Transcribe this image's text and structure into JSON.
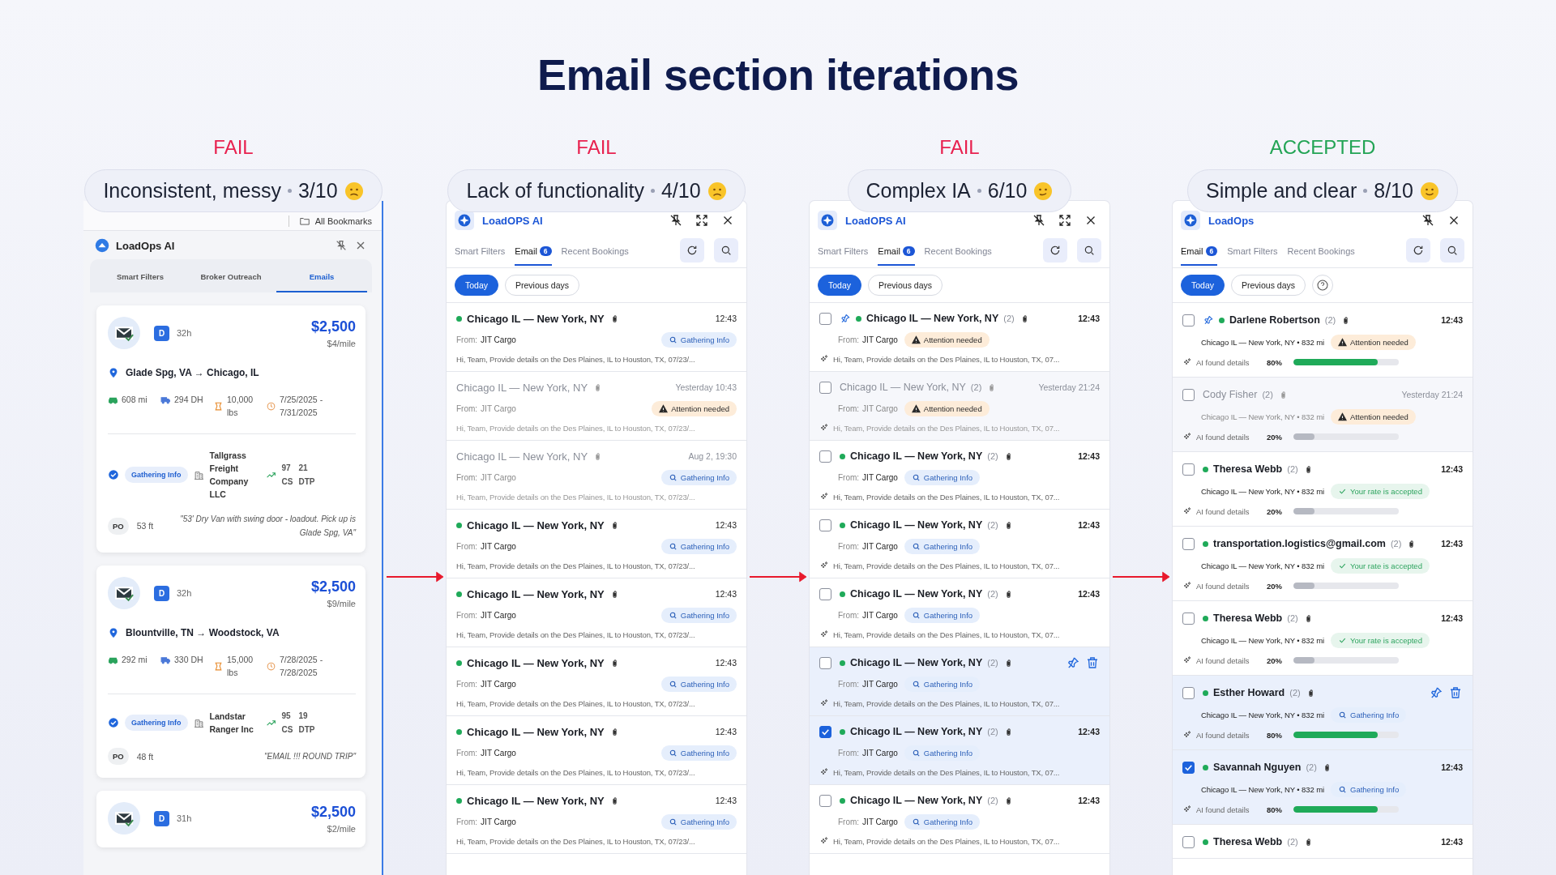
{
  "title": "Email section iterations",
  "columns": [
    {
      "verdict": "FAIL",
      "passed": false,
      "label": "Inconsistent, messy",
      "score": "3/10",
      "panel": {
        "kind": "cards",
        "bookmarks_label": "All Bookmarks",
        "app_name": "LoadOps AI",
        "tabs": [
          {
            "label": "Smart Filters",
            "selected": false
          },
          {
            "label": "Broker Outreach",
            "selected": false
          },
          {
            "label": "Emails",
            "selected": true
          }
        ],
        "cards": [
          {
            "badge": "D",
            "age": "32h",
            "price": "$2,500",
            "rate": "$4/mile",
            "route": "Glade Spg, VA → Chicago, IL",
            "stats": [
              {
                "kind": "distance",
                "text": "608 mi"
              },
              {
                "kind": "deadhead",
                "text": "294 DH"
              },
              {
                "kind": "weight",
                "text": "10,000 lbs"
              },
              {
                "kind": "dates",
                "text": "7/25/2025 - 7/31/2025"
              }
            ],
            "status": "Gathering Info",
            "company": "Tallgrass Freight Company LLC",
            "scores": [
              {
                "value": "97",
                "label": "CS"
              },
              {
                "value": "21",
                "label": "DTP"
              }
            ],
            "po": "PO",
            "length": "53 ft",
            "note": "\"53' Dry Van with swing door - loadout. Pick up is Glade Spg, VA\""
          },
          {
            "badge": "D",
            "age": "32h",
            "price": "$2,500",
            "rate": "$9/mile",
            "route": "Blountville, TN → Woodstock, VA",
            "stats": [
              {
                "kind": "distance",
                "text": "292 mi"
              },
              {
                "kind": "deadhead",
                "text": "330 DH"
              },
              {
                "kind": "weight",
                "text": "15,000 lbs"
              },
              {
                "kind": "dates",
                "text": "7/28/2025 - 7/28/2025"
              }
            ],
            "status": "Gathering Info",
            "company": "Landstar Ranger Inc",
            "scores": [
              {
                "value": "95",
                "label": "CS"
              },
              {
                "value": "19",
                "label": "DTP"
              }
            ],
            "po": "PO",
            "length": "48 ft",
            "note": "\"EMAIL !!! ROUND TRIP\""
          },
          {
            "badge": "D",
            "age": "31h",
            "price": "$2,500",
            "rate": "$2/mile"
          }
        ]
      }
    },
    {
      "verdict": "FAIL",
      "passed": false,
      "label": "Lack of functionality",
      "score": "4/10",
      "panel": {
        "kind": "simple",
        "app_name": "LoadOPS AI",
        "expand_button": true,
        "help_button": false,
        "tabs": [
          {
            "label": "Smart Filters",
            "selected": false
          },
          {
            "label": "Email",
            "badge": "6",
            "selected": true
          },
          {
            "label": "Recent Bookings",
            "selected": false
          }
        ],
        "filters": [
          {
            "label": "Today",
            "selected": true
          },
          {
            "label": "Previous days",
            "selected": false
          }
        ],
        "rows": [
          {
            "unread": true,
            "title": "Chicago IL — New York, NY",
            "time": "12:43",
            "from_label": "From:",
            "sender": "JIT Cargo",
            "status": {
              "kind": "info",
              "label": "Gathering Info"
            },
            "preview": "Hi, Team, Provide details on the Des Plaines, IL to Houston, TX, 07/23/..."
          },
          {
            "unread": false,
            "title": "Chicago IL — New York, NY",
            "time": "Yesterday 10:43",
            "from_label": "From:",
            "sender": "JIT Cargo",
            "status": {
              "kind": "attention",
              "label": "Attention needed"
            },
            "preview": "Hi, Team, Provide details on the Des Plaines, IL to Houston, TX, 07/23/..."
          },
          {
            "unread": false,
            "title": "Chicago IL — New York, NY",
            "time": "Aug 2, 19:30",
            "from_label": "From:",
            "sender": "JIT Cargo",
            "status": {
              "kind": "info",
              "label": "Gathering Info"
            },
            "preview": "Hi, Team, Provide details on the Des Plaines, IL to Houston, TX, 07/23/..."
          },
          {
            "unread": true,
            "title": "Chicago IL — New York, NY",
            "time": "12:43",
            "from_label": "From:",
            "sender": "JIT Cargo",
            "status": {
              "kind": "info",
              "label": "Gathering Info"
            },
            "preview": "Hi, Team, Provide details on the Des Plaines, IL to Houston, TX, 07/23/..."
          },
          {
            "unread": true,
            "title": "Chicago IL — New York, NY",
            "time": "12:43",
            "from_label": "From:",
            "sender": "JIT Cargo",
            "status": {
              "kind": "info",
              "label": "Gathering Info"
            },
            "preview": "Hi, Team, Provide details on the Des Plaines, IL to Houston, TX, 07/23/..."
          },
          {
            "unread": true,
            "title": "Chicago IL — New York, NY",
            "time": "12:43",
            "from_label": "From:",
            "sender": "JIT Cargo",
            "status": {
              "kind": "info",
              "label": "Gathering Info"
            },
            "preview": "Hi, Team, Provide details on the Des Plaines, IL to Houston, TX, 07/23/..."
          },
          {
            "unread": true,
            "title": "Chicago IL — New York, NY",
            "time": "12:43",
            "from_label": "From:",
            "sender": "JIT Cargo",
            "status": {
              "kind": "info",
              "label": "Gathering Info"
            },
            "preview": "Hi, Team, Provide details on the Des Plaines, IL to Houston, TX, 07/23/..."
          },
          {
            "unread": true,
            "title": "Chicago IL — New York, NY",
            "time": "12:43",
            "from_label": "From:",
            "sender": "JIT Cargo",
            "status": {
              "kind": "info",
              "label": "Gathering Info"
            },
            "preview": "Hi, Team, Provide details on the Des Plaines, IL to Houston, TX, 07/23/..."
          }
        ]
      }
    },
    {
      "verdict": "FAIL",
      "passed": false,
      "label": "Complex IA",
      "score": "6/10",
      "panel": {
        "kind": "checklist",
        "app_name": "LoadOPS AI",
        "expand_button": true,
        "help_button": false,
        "tabs": [
          {
            "label": "Smart Filters",
            "selected": false
          },
          {
            "label": "Email",
            "badge": "6",
            "selected": true
          },
          {
            "label": "Recent Bookings",
            "selected": false
          }
        ],
        "filters": [
          {
            "label": "Today",
            "selected": true
          },
          {
            "label": "Previous days",
            "selected": false
          }
        ],
        "rows": [
          {
            "checked": false,
            "pinned": true,
            "unread": true,
            "hovered": false,
            "title": "Chicago IL — New York, NY",
            "count": "(2)",
            "time": "12:43",
            "from_label": "From:",
            "sender": "JIT Cargo",
            "status": {
              "kind": "attention",
              "label": "Attention needed"
            },
            "preview": "Hi, Team, Provide details on the Des Plaines, IL to Houston, TX, 07..."
          },
          {
            "checked": false,
            "pinned": false,
            "unread": false,
            "hovered": false,
            "title": "Chicago IL — New York, NY",
            "count": "(2)",
            "time": "Yesterday 21:24",
            "from_label": "From:",
            "sender": "JIT Cargo",
            "status": {
              "kind": "attention",
              "label": "Attention needed"
            },
            "preview": "Hi, Team, Provide details on the Des Plaines, IL to Houston, TX, 07..."
          },
          {
            "checked": false,
            "pinned": false,
            "unread": true,
            "hovered": false,
            "title": "Chicago IL — New York, NY",
            "count": "(2)",
            "time": "12:43",
            "from_label": "From:",
            "sender": "JIT Cargo",
            "status": {
              "kind": "info",
              "label": "Gathering Info"
            },
            "preview": "Hi, Team, Provide details on the Des Plaines, IL to Houston, TX, 07..."
          },
          {
            "checked": false,
            "pinned": false,
            "unread": true,
            "hovered": false,
            "title": "Chicago IL — New York, NY",
            "count": "(2)",
            "time": "12:43",
            "from_label": "From:",
            "sender": "JIT Cargo",
            "status": {
              "kind": "info",
              "label": "Gathering Info"
            },
            "preview": "Hi, Team, Provide details on the Des Plaines, IL to Houston, TX, 07..."
          },
          {
            "checked": false,
            "pinned": false,
            "unread": true,
            "hovered": false,
            "title": "Chicago IL — New York, NY",
            "count": "(2)",
            "time": "12:43",
            "from_label": "From:",
            "sender": "JIT Cargo",
            "status": {
              "kind": "info",
              "label": "Gathering Info"
            },
            "preview": "Hi, Team, Provide details on the Des Plaines, IL to Houston, TX, 07..."
          },
          {
            "checked": false,
            "pinned": false,
            "unread": true,
            "hovered": true,
            "title": "Chicago IL — New York, NY",
            "count": "(2)",
            "from_label": "From:",
            "sender": "JIT Cargo",
            "status": {
              "kind": "info",
              "label": "Gathering Info"
            },
            "preview": "Hi, Team, Provide details on the Des Plaines, IL to Houston, TX, 07..."
          },
          {
            "checked": true,
            "pinned": false,
            "unread": true,
            "hovered": false,
            "title": "Chicago IL — New York, NY",
            "count": "(2)",
            "time": "12:43",
            "from_label": "From:",
            "sender": "JIT Cargo",
            "status": {
              "kind": "info",
              "label": "Gathering Info"
            },
            "preview": "Hi, Team, Provide details on the Des Plaines, IL to Houston, TX, 07..."
          },
          {
            "checked": false,
            "pinned": false,
            "unread": true,
            "hovered": false,
            "title": "Chicago IL — New York, NY",
            "count": "(2)",
            "time": "12:43",
            "from_label": "From:",
            "sender": "JIT Cargo",
            "status": {
              "kind": "info",
              "label": "Gathering Info"
            },
            "preview": "Hi, Team, Provide details on the Des Plaines, IL to Houston, TX, 07..."
          }
        ]
      }
    },
    {
      "verdict": "ACCEPTED",
      "passed": true,
      "label": "Simple and clear",
      "score": "8/10",
      "panel": {
        "kind": "progress",
        "app_name": "LoadOps",
        "expand_button": false,
        "help_button": true,
        "tabs": [
          {
            "label": "Email",
            "badge": "6",
            "selected": true
          },
          {
            "label": "Smart Filters",
            "selected": false
          },
          {
            "label": "Recent Bookings",
            "selected": false
          }
        ],
        "filters": [
          {
            "label": "Today",
            "selected": true
          },
          {
            "label": "Previous days",
            "selected": false
          }
        ],
        "rows": [
          {
            "checked": false,
            "pinned": true,
            "unread": true,
            "hovered": false,
            "title": "Darlene Robertson",
            "count": "(2)",
            "time": "12:43",
            "route": "Chicago IL — New York, NY • 832 mi",
            "status": {
              "kind": "attention",
              "label": "Attention needed"
            },
            "ai_label": "AI found details",
            "percent": "80%",
            "level": 0.8
          },
          {
            "checked": false,
            "pinned": false,
            "unread": false,
            "hovered": false,
            "title": "Cody Fisher",
            "count": "(2)",
            "time": "Yesterday 21:24",
            "route": "Chicago IL — New York, NY • 832 mi",
            "status": {
              "kind": "attention",
              "label": "Attention needed"
            },
            "ai_label": "AI found details",
            "percent": "20%",
            "level": 0.2
          },
          {
            "checked": false,
            "pinned": false,
            "unread": true,
            "hovered": false,
            "title": "Theresa Webb",
            "count": "(2)",
            "time": "12:43",
            "route": "Chicago IL — New York, NY • 832 mi",
            "status": {
              "kind": "accepted",
              "label": "Your rate is accepted"
            },
            "ai_label": "AI found details",
            "percent": "20%",
            "level": 0.2
          },
          {
            "checked": false,
            "pinned": false,
            "unread": true,
            "hovered": false,
            "title": "transportation.logistics@gmail.com",
            "count": "(2)",
            "time": "12:43",
            "route": "Chicago IL — New York, NY • 832 mi",
            "status": {
              "kind": "accepted",
              "label": "Your rate is accepted"
            },
            "ai_label": "AI found details",
            "percent": "20%",
            "level": 0.2
          },
          {
            "checked": false,
            "pinned": false,
            "unread": true,
            "hovered": false,
            "title": "Theresa Webb",
            "count": "(2)",
            "time": "12:43",
            "route": "Chicago IL — New York, NY • 832 mi",
            "status": {
              "kind": "accepted",
              "label": "Your rate is accepted"
            },
            "ai_label": "AI found details",
            "percent": "20%",
            "level": 0.2
          },
          {
            "checked": false,
            "pinned": false,
            "unread": true,
            "hovered": true,
            "title": "Esther Howard",
            "count": "(2)",
            "route": "Chicago IL — New York, NY • 832 mi",
            "status": {
              "kind": "info",
              "label": "Gathering Info"
            },
            "ai_label": "AI found details",
            "percent": "80%",
            "level": 0.8
          },
          {
            "checked": true,
            "pinned": false,
            "unread": true,
            "hovered": false,
            "title": "Savannah Nguyen",
            "count": "(2)",
            "time": "12:43",
            "route": "Chicago IL — New York, NY • 832 mi",
            "status": {
              "kind": "info",
              "label": "Gathering Info"
            },
            "ai_label": "AI found details",
            "percent": "80%",
            "level": 0.8
          },
          {
            "checked": false,
            "pinned": false,
            "unread": true,
            "hovered": false,
            "title": "Theresa Webb",
            "count": "(2)",
            "time": "12:43"
          }
        ]
      }
    }
  ]
}
